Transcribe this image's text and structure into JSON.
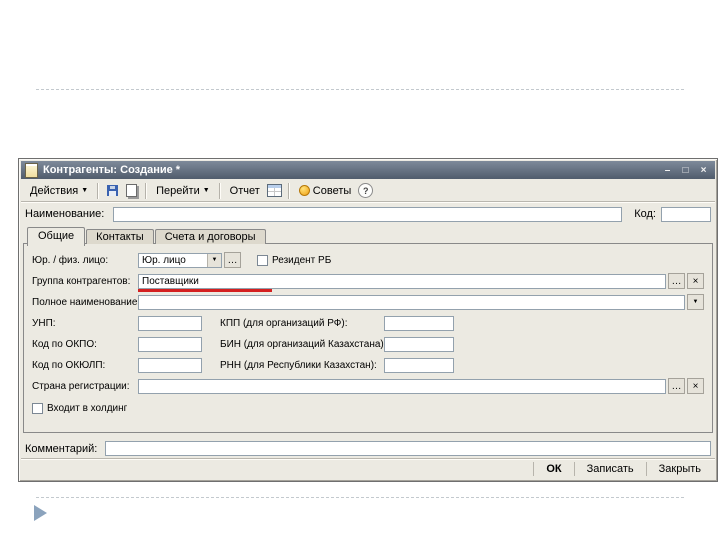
{
  "colors": {
    "annotation_red": "#d42020",
    "titlebar_top": "#7e8a9a",
    "titlebar_bottom": "#505c6c",
    "form_background": "#eceae2"
  },
  "glyphs": {
    "chevron_down": "▼",
    "ellipsis": "…",
    "clear": "×",
    "minimize": "–",
    "maximize": "□",
    "close": "×",
    "help": "?"
  },
  "window": {
    "title": "Контрагенты: Создание *",
    "toolbar": {
      "actions": "Действия",
      "goto": "Перейти",
      "report": "Отчет",
      "tips": "Советы",
      "icons": [
        "save-icon",
        "copy-icon",
        "table-icon",
        "tips-bee-icon",
        "help-icon"
      ]
    },
    "form": {
      "name_label": "Наименование:",
      "name_value": "",
      "code_label": "Код:",
      "code_value": "",
      "tabs": [
        {
          "label": "Общие",
          "active": true
        },
        {
          "label": "Контакты",
          "active": false
        },
        {
          "label": "Счета и договоры",
          "active": false
        }
      ],
      "general": {
        "entity_type_label": "Юр. / физ. лицо:",
        "entity_type_value": "Юр. лицо",
        "resident_label": "Резидент РБ",
        "group_label": "Группа контрагентов:",
        "group_value": "Поставщики",
        "full_name_label": "Полное наименование:",
        "full_name_value": "",
        "unp_label": "УНП:",
        "unp_value": "",
        "kpp_label": "КПП (для организаций РФ):",
        "kpp_value": "",
        "okpo_label": "Код по ОКПО:",
        "okpo_value": "",
        "bin_label": "БИН (для организаций Казахстана):",
        "bin_value": "",
        "okyulp_label": "Код по ОКЮЛП:",
        "okyulp_value": "",
        "rnn_label": "РНН (для Республики Казахстан):",
        "rnn_value": "",
        "country_label": "Страна регистрации:",
        "country_value": "",
        "holding_label": "Входит в холдинг"
      },
      "comment_label": "Комментарий:",
      "comment_value": "",
      "buttons": {
        "ok": "ОК",
        "write": "Записать",
        "close": "Закрыть"
      }
    }
  }
}
